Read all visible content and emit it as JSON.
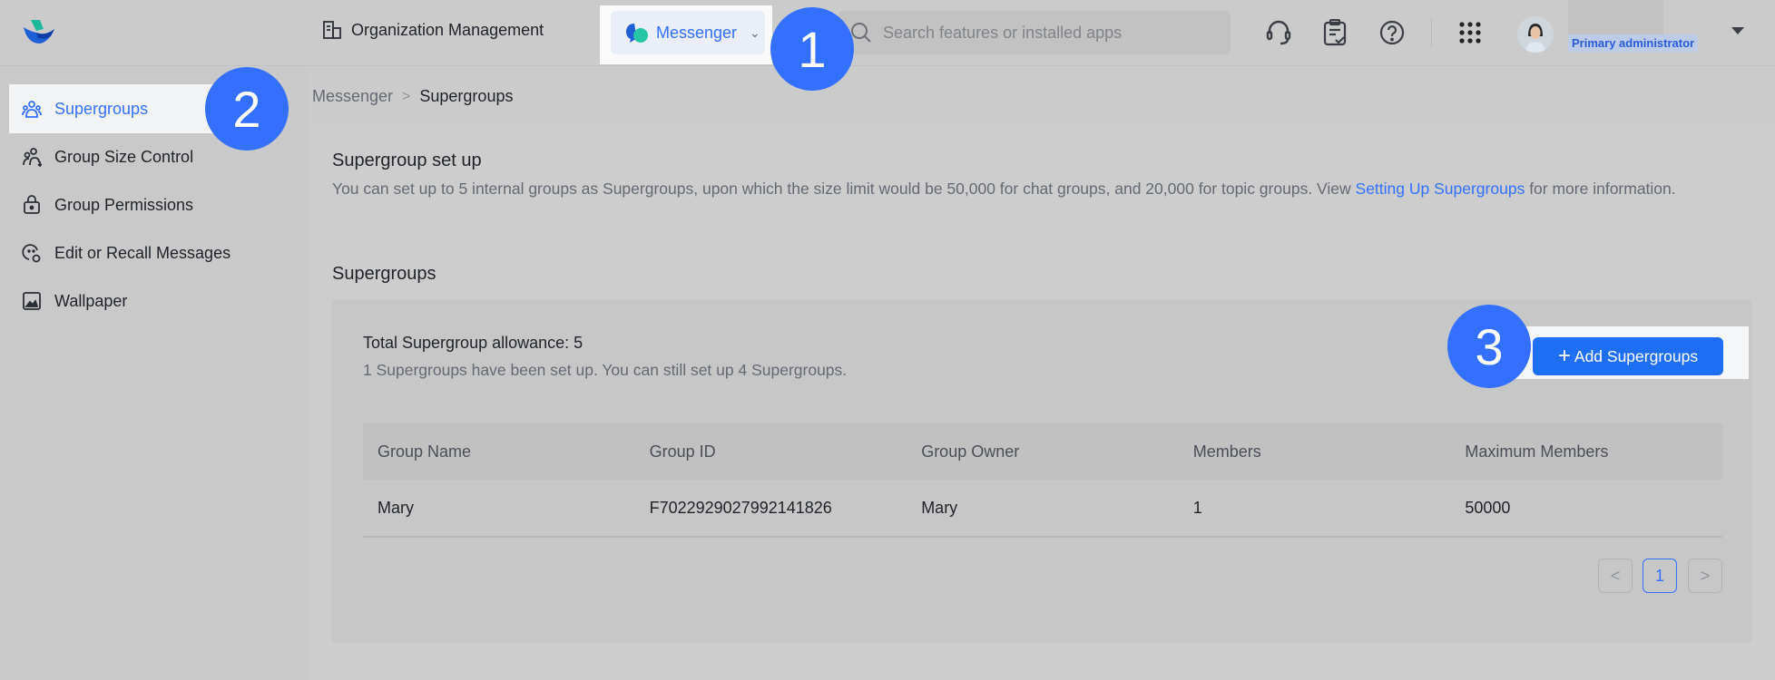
{
  "header": {
    "logo_icon": "app-logo",
    "org_management_label": "Organization Management",
    "app_switcher": {
      "label": "Messenger",
      "icon": "messenger-bubble-icon"
    },
    "search": {
      "placeholder": "Search features or installed apps"
    },
    "icons": [
      "headset-icon",
      "checklist-icon",
      "help-icon",
      "app-grid-icon"
    ],
    "user": {
      "role": "Primary administrator"
    }
  },
  "sidebar": {
    "items": [
      {
        "label": "Supergroups",
        "icon": "group-icon",
        "active": true
      },
      {
        "label": "Group Size Control",
        "icon": "group-size-icon",
        "active": false
      },
      {
        "label": "Group Permissions",
        "icon": "lock-bag-icon",
        "active": false
      },
      {
        "label": "Edit or Recall Messages",
        "icon": "message-recall-icon",
        "active": false
      },
      {
        "label": "Wallpaper",
        "icon": "image-icon",
        "active": false
      }
    ]
  },
  "breadcrumb": {
    "parent": "Messenger",
    "separator": ">",
    "current": "Supergroups"
  },
  "setup": {
    "title": "Supergroup set up",
    "desc_before": "You can set up to 5 internal groups as Supergroups, upon which the size limit would be 50,000 for chat groups, and 20,000 for topic groups. View ",
    "link": "Setting Up Supergroups",
    "desc_after": " for more information."
  },
  "supergroups": {
    "title": "Supergroups",
    "allowance": "Total Supergroup allowance: 5",
    "status": "1 Supergroups have been set up. You can still set up 4 Supergroups.",
    "add_button": "Add Supergroups",
    "table": {
      "columns": [
        "Group Name",
        "Group ID",
        "Group Owner",
        "Members",
        "Maximum Members"
      ],
      "rows": [
        [
          "Mary",
          "F7022929027992141826",
          "Mary",
          "1",
          "50000"
        ]
      ]
    },
    "pagination": {
      "prev": "<",
      "current": "1",
      "next": ">"
    }
  },
  "annotations": [
    "1",
    "2",
    "3"
  ]
}
